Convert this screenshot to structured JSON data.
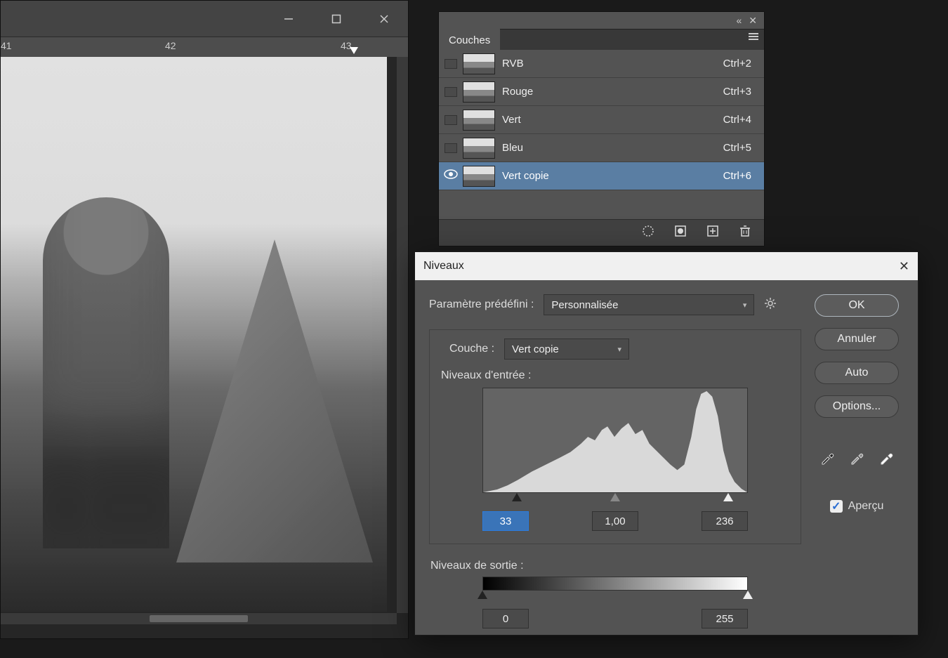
{
  "ruler": {
    "t1": "41",
    "t2": "42",
    "t3": "43"
  },
  "channels_panel": {
    "tab_label": "Couches",
    "rows": [
      {
        "name": "RVB",
        "shortcut": "Ctrl+2",
        "selected": false,
        "visible": false
      },
      {
        "name": "Rouge",
        "shortcut": "Ctrl+3",
        "selected": false,
        "visible": false
      },
      {
        "name": "Vert",
        "shortcut": "Ctrl+4",
        "selected": false,
        "visible": false
      },
      {
        "name": "Bleu",
        "shortcut": "Ctrl+5",
        "selected": false,
        "visible": false
      },
      {
        "name": "Vert copie",
        "shortcut": "Ctrl+6",
        "selected": true,
        "visible": true
      }
    ]
  },
  "levels": {
    "title": "Niveaux",
    "preset_label": "Paramètre prédéfini :",
    "preset_value": "Personnalisée",
    "channel_label": "Couche :",
    "channel_value": "Vert copie",
    "input_levels_label": "Niveaux d'entrée :",
    "input_shadow": "33",
    "input_mid": "1,00",
    "input_high": "236",
    "output_levels_label": "Niveaux de sortie :",
    "output_low": "0",
    "output_high": "255",
    "buttons": {
      "ok": "OK",
      "cancel": "Annuler",
      "auto": "Auto",
      "options": "Options..."
    },
    "preview_label": "Aperçu",
    "preview_checked": true
  }
}
